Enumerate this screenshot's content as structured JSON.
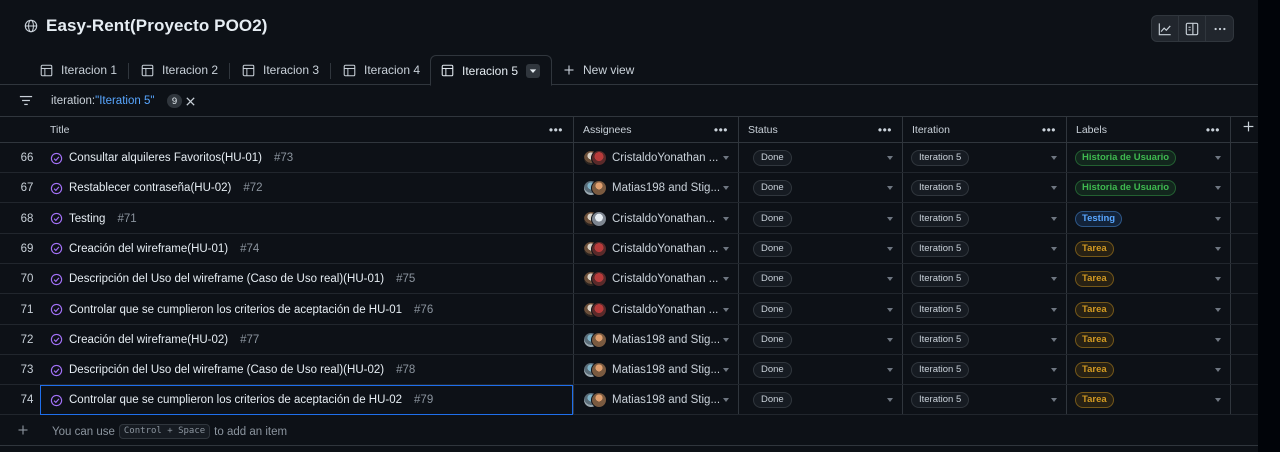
{
  "project": {
    "title": "Easy-Rent(Proyecto POO2)",
    "icon": "globe-icon"
  },
  "header_tools": [
    {
      "name": "insights-icon"
    },
    {
      "name": "panel-icon"
    },
    {
      "name": "kebab-icon"
    }
  ],
  "tabs": [
    {
      "label": "Iteracion 1",
      "active": false
    },
    {
      "label": "Iteracion 2",
      "active": false
    },
    {
      "label": "Iteracion 3",
      "active": false
    },
    {
      "label": "Iteracion 4",
      "active": false
    },
    {
      "label": "Iteracion 5",
      "active": true
    }
  ],
  "new_view_label": "New view",
  "filter": {
    "key": "iteration:",
    "value": "\"Iteration 5\"",
    "count": "9"
  },
  "columns": {
    "title": "Title",
    "assignees": "Assignees",
    "status": "Status",
    "iteration": "Iteration",
    "labels": "Labels"
  },
  "rows": [
    {
      "num": "66",
      "title": "Consultar alquileres Favoritos(HU-01)",
      "issue": "#73",
      "assignees": "CristaldoYonathan ...",
      "avatars": "cy",
      "status": "Done",
      "iteration": "Iteration 5",
      "label": "Historia de Usuario",
      "label_kind": "green"
    },
    {
      "num": "67",
      "title": "Restablecer contraseña(HU-02)",
      "issue": "#72",
      "assignees": "Matias198 and Stig...",
      "avatars": "ms",
      "status": "Done",
      "iteration": "Iteration 5",
      "label": "Historia de Usuario",
      "label_kind": "green"
    },
    {
      "num": "68",
      "title": "Testing",
      "issue": "#71",
      "assignees": "CristaldoYonathan...",
      "avatars": "cy2",
      "status": "Done",
      "iteration": "Iteration 5",
      "label": "Testing",
      "label_kind": "blue"
    },
    {
      "num": "69",
      "title": "Creación del wireframe(HU-01)",
      "issue": "#74",
      "assignees": "CristaldoYonathan ...",
      "avatars": "cy",
      "status": "Done",
      "iteration": "Iteration 5",
      "label": "Tarea",
      "label_kind": "orange"
    },
    {
      "num": "70",
      "title": "Descripción del Uso del wireframe (Caso de Uso real)(HU-01)",
      "issue": "#75",
      "assignees": "CristaldoYonathan ...",
      "avatars": "cy",
      "status": "Done",
      "iteration": "Iteration 5",
      "label": "Tarea",
      "label_kind": "orange"
    },
    {
      "num": "71",
      "title": "Controlar que se cumplieron los criterios de aceptación de HU-01",
      "issue": "#76",
      "assignees": "CristaldoYonathan ...",
      "avatars": "cy",
      "status": "Done",
      "iteration": "Iteration 5",
      "label": "Tarea",
      "label_kind": "orange"
    },
    {
      "num": "72",
      "title": "Creación del wireframe(HU-02)",
      "issue": "#77",
      "assignees": "Matias198 and Stig...",
      "avatars": "ms",
      "status": "Done",
      "iteration": "Iteration 5",
      "label": "Tarea",
      "label_kind": "orange"
    },
    {
      "num": "73",
      "title": "Descripción del Uso del wireframe (Caso de Uso real)(HU-02)",
      "issue": "#78",
      "assignees": "Matias198 and Stig...",
      "avatars": "ms",
      "status": "Done",
      "iteration": "Iteration 5",
      "label": "Tarea",
      "label_kind": "orange"
    },
    {
      "num": "74",
      "title": "Controlar que se cumplieron los criterios de aceptación de HU-02",
      "issue": "#79",
      "assignees": "Matias198 and Stig...",
      "avatars": "ms",
      "status": "Done",
      "iteration": "Iteration 5",
      "label": "Tarea",
      "label_kind": "orange"
    }
  ],
  "add_item": {
    "prefix": "You can use",
    "shortcut": "Control + Space",
    "suffix": "to add an item"
  },
  "colors": {
    "background": "#0d1117",
    "border": "#30363d",
    "accent": "#58a6ff",
    "done_icon": "#a371f7",
    "label_green_text": "#3fb950",
    "label_blue_text": "#58a6ff",
    "label_orange_text": "#d29922"
  }
}
